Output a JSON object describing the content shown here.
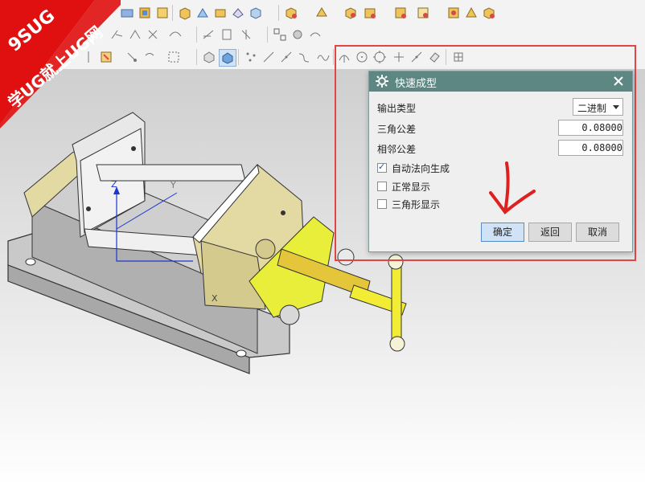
{
  "watermark": {
    "line1": "9SUG",
    "line2": "学UG就上UG网"
  },
  "toolbar": {
    "icons_row1": [
      "sphere-icon",
      "box-icon",
      "face-icon",
      "block-icon",
      "sweep-icon",
      "extrude-icon",
      "revolve-icon",
      "feature-icon",
      "shell-icon",
      "offset-icon",
      "blend-icon",
      "chamfer-icon",
      "trim-icon",
      "split-icon",
      "pattern-icon",
      "mirror-icon",
      "measure-icon",
      "section-icon",
      "analysis-icon"
    ],
    "icons_row2": [
      "sketch-icon",
      "curve-icon",
      "line-icon",
      "arc-icon",
      "spline-icon",
      "offset-curve-icon",
      "project-icon",
      "intersect-icon",
      "bridge-icon",
      "join-icon",
      "extract-icon",
      "isoparam-icon"
    ],
    "icons_row3": [
      "snap-icon",
      "select-filter-icon",
      "pick-icon",
      "rotate-icon",
      "box-select-icon",
      "view-shaded-icon",
      "view-solid-icon",
      "point-scatter-icon",
      "line-tool-icon",
      "polyline-icon",
      "curve-tool-icon",
      "wave-icon",
      "arc-tool-icon",
      "circle-icon",
      "circle-center-icon",
      "plus-icon",
      "slash-icon",
      "eraser-icon",
      "grid-icon"
    ]
  },
  "dialog": {
    "title": "快速成型",
    "output_type_label": "输出类型",
    "output_type_value": "二进制",
    "triangle_tol_label": "三角公差",
    "triangle_tol_value": "0.08000",
    "adjacent_tol_label": "相邻公差",
    "adjacent_tol_value": "0.08000",
    "checkboxes": [
      {
        "label": "自动法向生成",
        "checked": true
      },
      {
        "label": "正常显示",
        "checked": false
      },
      {
        "label": "三角形显示",
        "checked": false
      }
    ],
    "ok_label": "确定",
    "back_label": "返回",
    "cancel_label": "取消"
  },
  "viewport": {
    "axis_z": "Z",
    "axis_y": "Y",
    "axis_x": "X"
  },
  "colors": {
    "dialog_title_bg": "#5d8783",
    "highlight": "#e24545",
    "watermark_red": "#e01010",
    "handle_yellow": "#f2ec34",
    "vise_body": "#d9cf8a"
  }
}
